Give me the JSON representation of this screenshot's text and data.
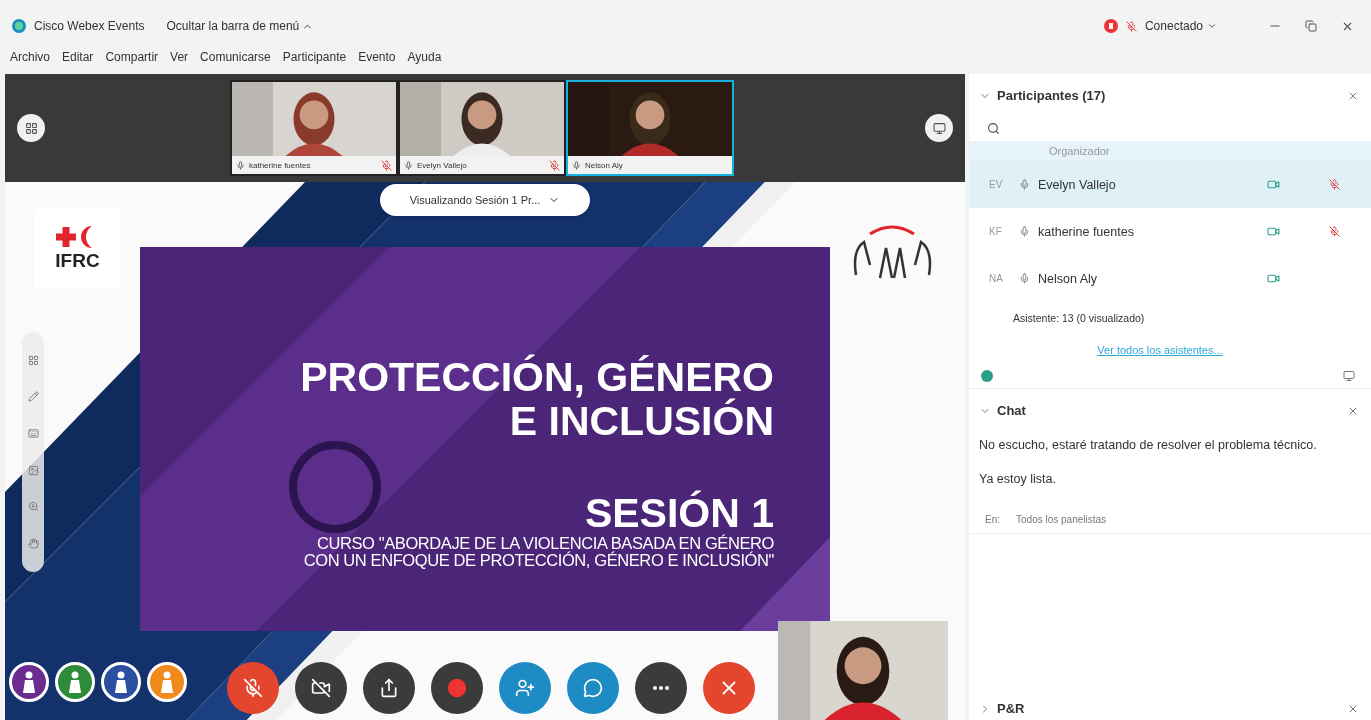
{
  "app_bar": {
    "title": "Cisco Webex Events",
    "menu_toggle": "Ocultar la barra de menú",
    "status": "Conectado"
  },
  "menu": [
    "Archivo",
    "Editar",
    "Compartir",
    "Ver",
    "Comunicarse",
    "Participante",
    "Evento",
    "Ayuda"
  ],
  "video_strip": [
    {
      "name": "katherine fuentes",
      "muted": true,
      "selected": false
    },
    {
      "name": "Evelyn Vallejo",
      "muted": true,
      "selected": false
    },
    {
      "name": "Nelson Aly",
      "muted": false,
      "selected": true
    }
  ],
  "viewing": "Visualizando Sesión 1 Pr...",
  "slide": {
    "logo_text": "IFRC",
    "title_lines": [
      "PROTECCIÓN, GÉNERO",
      "E INCLUSIÓN"
    ],
    "session": "SESIÓN 1",
    "subtitle_lines": [
      "CURSO \"ABORDAJE DE LA VIOLENCIA BASADA EN GÉNERO",
      "CON UN ENFOQUE DE PROTECCIÓN, GÉNERO E INCLUSIÓN\""
    ]
  },
  "slide_badges": [
    {
      "color": "#6a2c8e"
    },
    {
      "color": "#2e8b3a"
    },
    {
      "color": "#2a4fa0"
    },
    {
      "color": "#f08a1c"
    }
  ],
  "controls": [
    {
      "kind": "mute",
      "color": "#e4452d"
    },
    {
      "kind": "video",
      "color": "#3b3b3b"
    },
    {
      "kind": "share",
      "color": "#3b3b3b"
    },
    {
      "kind": "record",
      "color": "#3b3b3b"
    },
    {
      "kind": "participants",
      "color": "#1d8cc4"
    },
    {
      "kind": "chat",
      "color": "#1d8cc4"
    },
    {
      "kind": "more",
      "color": "#3b3b3b"
    },
    {
      "kind": "leave",
      "color": "#e4452d"
    }
  ],
  "participants": {
    "title": "Participantes (17)",
    "organizer_label": "Organizador",
    "rows": [
      {
        "initials": "EV",
        "name": "Evelyn Vallejo",
        "selected": true,
        "muted": true
      },
      {
        "initials": "KF",
        "name": "katherine fuentes",
        "selected": false,
        "muted": true
      },
      {
        "initials": "NA",
        "name": "Nelson Aly",
        "selected": false,
        "muted": false
      }
    ],
    "attendees": "Asistente: 13 (0 visualizado)",
    "link": "Ver todos los asistentes..."
  },
  "chat": {
    "title": "Chat",
    "messages": [
      "No escucho, estaré tratando de resolver el problema técnico.",
      "Ya estoy lista."
    ],
    "to_label": "En:",
    "to_value": "Todos los panelistas"
  },
  "qa": {
    "title": "P&R"
  }
}
